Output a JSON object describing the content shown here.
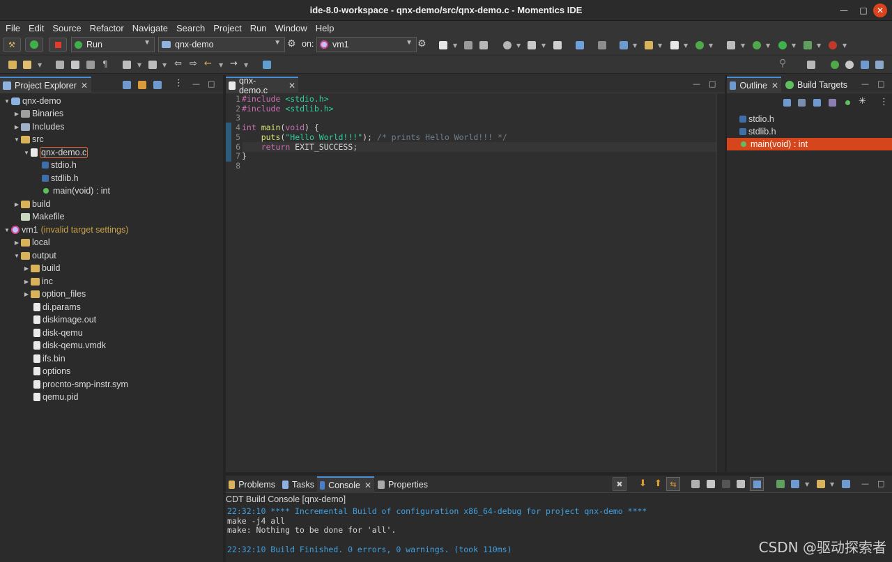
{
  "window": {
    "title": "ide-8.0-workspace - qnx-demo/src/qnx-demo.c - Momentics IDE"
  },
  "menu": [
    "File",
    "Edit",
    "Source",
    "Refactor",
    "Navigate",
    "Search",
    "Project",
    "Run",
    "Window",
    "Help"
  ],
  "toolbar": {
    "launch_mode": "Run",
    "launch_config": "qnx-demo",
    "on_label": "on:",
    "launch_target": "vm1"
  },
  "project_explorer": {
    "tab_label": "Project Explorer",
    "tree": [
      {
        "label": "qnx-demo",
        "level": 0,
        "expanded": true,
        "icon": "project-icon"
      },
      {
        "label": "Binaries",
        "level": 1,
        "expanded": false,
        "icon": "binaries-icon"
      },
      {
        "label": "Includes",
        "level": 1,
        "expanded": false,
        "icon": "includes-icon"
      },
      {
        "label": "src",
        "level": 1,
        "expanded": true,
        "icon": "source-folder-icon"
      },
      {
        "label": "qnx-demo.c",
        "level": 2,
        "expanded": true,
        "icon": "c-file-icon",
        "selected": true
      },
      {
        "label": "stdio.h",
        "level": 3,
        "icon": "header-icon"
      },
      {
        "label": "stdlib.h",
        "level": 3,
        "icon": "header-icon"
      },
      {
        "label": "main(void) : int",
        "level": 3,
        "icon": "function-icon"
      },
      {
        "label": "build",
        "level": 1,
        "expanded": false,
        "icon": "folder-icon"
      },
      {
        "label": "Makefile",
        "level": 1,
        "icon": "makefile-icon"
      },
      {
        "label": "vm1",
        "level": 0,
        "expanded": true,
        "icon": "target-icon",
        "note": "(invalid target settings)"
      },
      {
        "label": "local",
        "level": 1,
        "expanded": false,
        "icon": "folder-icon"
      },
      {
        "label": "output",
        "level": 1,
        "expanded": true,
        "icon": "folder-icon"
      },
      {
        "label": "build",
        "level": 2,
        "expanded": false,
        "icon": "folder-icon"
      },
      {
        "label": "inc",
        "level": 2,
        "expanded": false,
        "icon": "folder-icon"
      },
      {
        "label": "option_files",
        "level": 2,
        "expanded": false,
        "icon": "folder-icon"
      },
      {
        "label": "di.params",
        "level": 2,
        "icon": "file-icon"
      },
      {
        "label": "diskimage.out",
        "level": 2,
        "icon": "file-icon"
      },
      {
        "label": "disk-qemu",
        "level": 2,
        "icon": "file-icon"
      },
      {
        "label": "disk-qemu.vmdk",
        "level": 2,
        "icon": "file-icon"
      },
      {
        "label": "ifs.bin",
        "level": 2,
        "icon": "file-icon"
      },
      {
        "label": "options",
        "level": 2,
        "icon": "file-icon"
      },
      {
        "label": "procnto-smp-instr.sym",
        "level": 2,
        "icon": "file-icon"
      },
      {
        "label": "qemu.pid",
        "level": 2,
        "icon": "file-icon"
      }
    ]
  },
  "editor": {
    "tab_label": "qnx-demo.c",
    "lines": [
      {
        "n": "1",
        "parts": [
          [
            "kw",
            "#include "
          ],
          [
            "inc",
            "<stdio.h>"
          ]
        ]
      },
      {
        "n": "2",
        "parts": [
          [
            "kw",
            "#include "
          ],
          [
            "inc",
            "<stdlib.h>"
          ]
        ]
      },
      {
        "n": "3",
        "parts": []
      },
      {
        "n": "4",
        "parts": [
          [
            "kw",
            "int "
          ],
          [
            "fn",
            "main"
          ],
          [
            "ct",
            "("
          ],
          [
            "kw",
            "void"
          ],
          [
            "ct",
            ") {"
          ]
        ]
      },
      {
        "n": "5",
        "parts": [
          [
            "ct",
            "    "
          ],
          [
            "fn",
            "puts"
          ],
          [
            "ct",
            "("
          ],
          [
            "str",
            "\"Hello World!!!\""
          ],
          [
            "ct",
            "); "
          ],
          [
            "cm",
            "/* prints Hello World!!! */"
          ]
        ]
      },
      {
        "n": "6",
        "parts": [
          [
            "ct",
            "    "
          ],
          [
            "kw",
            "return "
          ],
          [
            "ct",
            "EXIT_SUCCESS;"
          ]
        ]
      },
      {
        "n": "7",
        "parts": [
          [
            "ct",
            "}"
          ]
        ]
      },
      {
        "n": "8",
        "parts": []
      }
    ]
  },
  "outline": {
    "tabs": [
      "Outline",
      "Build Targets"
    ],
    "items": [
      {
        "label": "stdio.h",
        "icon": "header-icon"
      },
      {
        "label": "stdlib.h",
        "icon": "header-icon"
      },
      {
        "label": "main(void) : int",
        "icon": "function-icon",
        "selected": true
      }
    ]
  },
  "bottom": {
    "tabs": [
      "Problems",
      "Tasks",
      "Console",
      "Properties"
    ],
    "active_tab": "Console",
    "console_title": "CDT Build Console [qnx-demo]",
    "lines": [
      {
        "style": "info",
        "text": "22:32:10 **** Incremental Build of configuration x86_64-debug for project qnx-demo ****"
      },
      {
        "style": "plain",
        "text": "make -j4 all"
      },
      {
        "style": "plain",
        "text": "make: Nothing to be done for 'all'."
      },
      {
        "style": "plain",
        "text": ""
      },
      {
        "style": "info",
        "text": "22:32:10 Build Finished. 0 errors, 0 warnings. (took 110ms)"
      }
    ]
  },
  "watermark": "CSDN @驱动探索者",
  "colors": {
    "accent": "#4a8fd6",
    "selection": "#d5461d",
    "console_info": "#3fa0e0"
  }
}
